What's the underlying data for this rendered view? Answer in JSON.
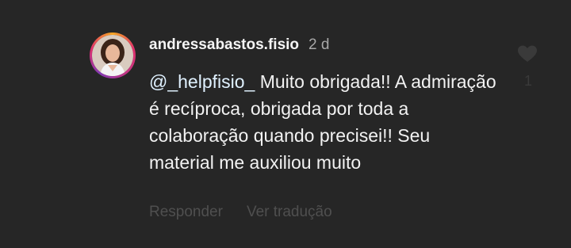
{
  "comment": {
    "username": "andressabastos.fisio",
    "timestamp": "2 d",
    "mention": "@_helpfisio_",
    "text": " Muito obrigada!! A admiração é recíproca, obrigada por toda a colaboração quando precisei!! Seu material me auxiliou muito",
    "like_count": "1",
    "like_icon": "heart-icon",
    "avatar_ring_colors": [
      "#f5a623",
      "#e1306c",
      "#c13584",
      "#833ab4"
    ]
  },
  "actions": {
    "reply_label": "Responder",
    "translate_label": "Ver tradução"
  },
  "colors": {
    "background": "#262626",
    "text_primary": "#f2f2f2",
    "text_secondary": "#a8a8a8",
    "actions_dim": "#4f4f4f"
  }
}
